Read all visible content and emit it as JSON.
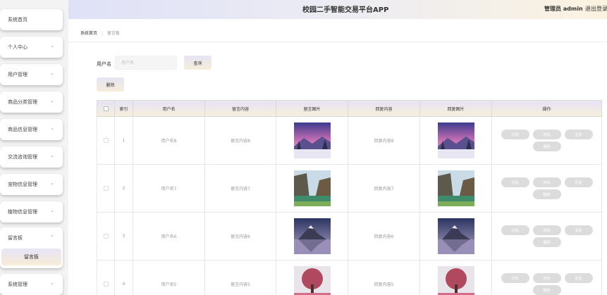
{
  "header": {
    "title": "校园二手智能交易平台APP",
    "role": "管理员 admin",
    "logout": "退出登录"
  },
  "sidebar": {
    "items": [
      {
        "label": "系统首页",
        "chevron": false
      },
      {
        "label": "个人中心",
        "chevron": true
      },
      {
        "label": "用户管理",
        "chevron": true
      },
      {
        "label": "商品分类管理",
        "chevron": true
      },
      {
        "label": "商品信息管理",
        "chevron": true
      },
      {
        "label": "交流咨询管理",
        "chevron": true
      },
      {
        "label": "宠物信息管理",
        "chevron": true
      },
      {
        "label": "植物信息管理",
        "chevron": true
      }
    ],
    "open_group": {
      "label": "留言板",
      "sub_item": "留言板"
    },
    "last_item": {
      "label": "系统管理"
    }
  },
  "breadcrumb": {
    "home": "系统首页",
    "sep": "|",
    "current": "留言板"
  },
  "search": {
    "label": "用户名",
    "placeholder": "用户名",
    "query_button": "查询"
  },
  "delete_button": "删除",
  "table": {
    "headers": [
      "索引",
      "用户名",
      "留言内容",
      "留言图片",
      "回复内容",
      "回复图片",
      "操作"
    ],
    "rows": [
      {
        "index": "1",
        "username": "用户名8",
        "content": "留言内容8",
        "reply": "回复内容8",
        "image": "winter-sunset-image"
      },
      {
        "index": "2",
        "username": "用户名7",
        "content": "留言内容7",
        "reply": "回复内容7",
        "image": "canyon-lake-image"
      },
      {
        "index": "3",
        "username": "用户名6",
        "content": "留言内容6",
        "reply": "回复内容6",
        "image": "mountain-lake-image"
      },
      {
        "index": "4",
        "username": "用户名5",
        "content": "留言内容5",
        "reply": "回复内容5",
        "image": "pink-tree-image"
      }
    ],
    "actions": [
      "详情",
      "修改",
      "回复",
      "删除"
    ]
  },
  "colors": {
    "header_left": "#dfe1f7",
    "header_right": "#fbf2e0",
    "button_gradient_top": "#e6e4f5",
    "button_gradient_bottom": "#f6edd9",
    "action_button": "#dcdcdc"
  }
}
